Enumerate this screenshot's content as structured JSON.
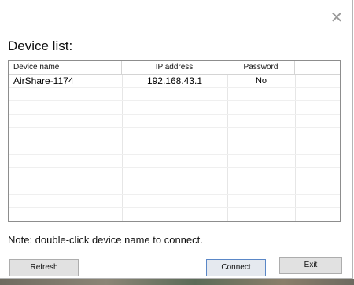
{
  "window": {
    "close_glyph": "✕"
  },
  "title": "Device list:",
  "table": {
    "columns": [
      "Device name",
      "IP address",
      "Password"
    ],
    "rows": [
      [
        "AirShare-1174",
        "192.168.43.1",
        "No"
      ]
    ]
  },
  "note": "Note: double-click device name to connect.",
  "buttons": {
    "refresh": "Refresh",
    "connect": "Connect",
    "exit": "Exit"
  }
}
